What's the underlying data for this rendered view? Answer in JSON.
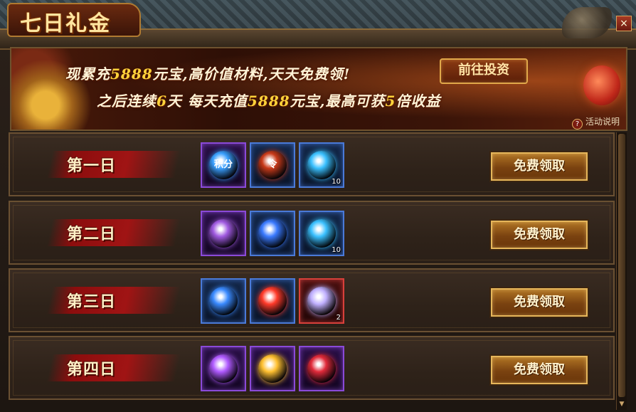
{
  "window": {
    "title": "七日礼金",
    "close_glyph": "×"
  },
  "banner": {
    "line1": {
      "prefix": "现累充",
      "amount": "5888",
      "suffix": "元宝,高价值材料,天天免费领!"
    },
    "line2": {
      "prefix": "之后连续",
      "days": "6",
      "mid": "天 每天充值",
      "amount": "5888",
      "mid2": "元宝,最高可获",
      "mult": "5",
      "suffix": "倍收益"
    },
    "invest_button": "前往投资",
    "help": {
      "icon": "?",
      "label": "活动说明"
    }
  },
  "rows": [
    {
      "day": "第一日",
      "claim": "免费领取",
      "items": [
        {
          "icon": "jifen-orb-icon",
          "rarity": "purple",
          "count": "",
          "color": "#3aa0ff",
          "text": "积分"
        },
        {
          "icon": "scroll-token-icon",
          "rarity": "blue",
          "count": "",
          "color": "#c83a1a",
          "text": "令"
        },
        {
          "icon": "feather-icon",
          "rarity": "blue",
          "count": "10",
          "color": "#3ac0ff",
          "text": ""
        }
      ]
    },
    {
      "day": "第二日",
      "claim": "免费领取",
      "items": [
        {
          "icon": "purple-orb-icon",
          "rarity": "purple",
          "count": "",
          "color": "#a05ae0",
          "text": ""
        },
        {
          "icon": "blue-gem-icon",
          "rarity": "blue",
          "count": "",
          "color": "#3a7aff",
          "text": ""
        },
        {
          "icon": "feather-icon",
          "rarity": "blue",
          "count": "10",
          "color": "#3ac0ff",
          "text": ""
        }
      ]
    },
    {
      "day": "第三日",
      "claim": "免费领取",
      "items": [
        {
          "icon": "blue-rune-orb-icon",
          "rarity": "blue",
          "count": "",
          "color": "#3a8aff",
          "text": ""
        },
        {
          "icon": "red-rune-orb-icon",
          "rarity": "blue",
          "count": "",
          "color": "#ff3a2a",
          "text": ""
        },
        {
          "icon": "swirl-crystal-icon",
          "rarity": "red",
          "count": "2",
          "color": "#c0b0ff",
          "text": ""
        }
      ]
    },
    {
      "day": "第四日",
      "claim": "免费领取",
      "items": [
        {
          "icon": "crystal-ball-icon",
          "rarity": "purple",
          "count": "",
          "color": "#b05aff",
          "text": ""
        },
        {
          "icon": "golden-rune-orb-icon",
          "rarity": "purple",
          "count": "",
          "color": "#ffc030",
          "text": ""
        },
        {
          "icon": "red-crystal-icon",
          "rarity": "purple",
          "count": "",
          "color": "#e02a3a",
          "text": ""
        }
      ]
    }
  ]
}
